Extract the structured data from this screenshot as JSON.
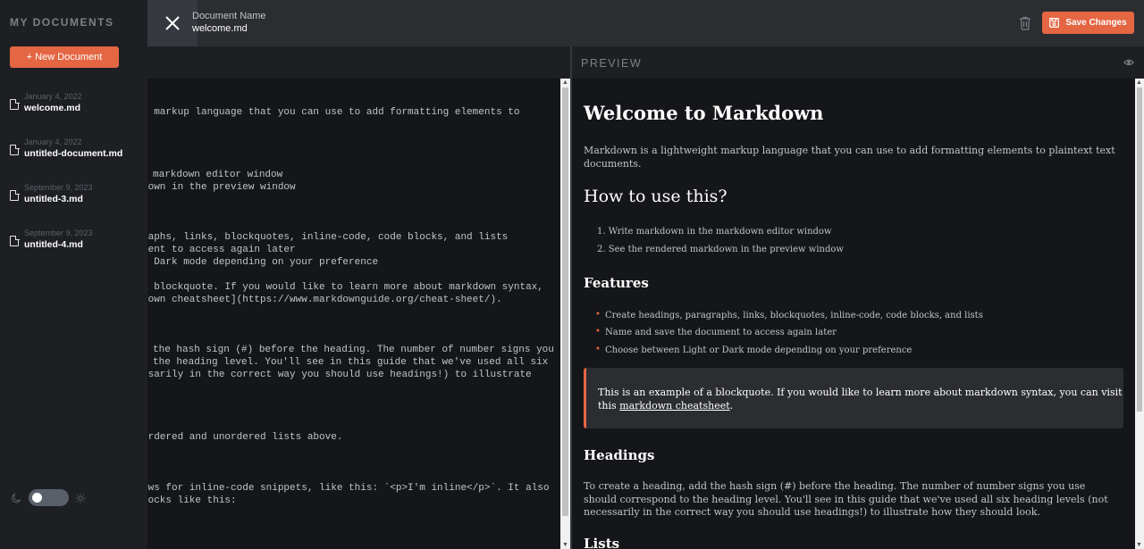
{
  "sidebar": {
    "title": "MY DOCUMENTS",
    "new_document_label": "+ New Document",
    "documents": [
      {
        "date": "January 4, 2022",
        "name": "welcome.md"
      },
      {
        "date": "January 4, 2022",
        "name": "untitled-document.md"
      },
      {
        "date": "September 9, 2023",
        "name": "untitled-3.md"
      },
      {
        "date": "September 9, 2023",
        "name": "untitled-4.md"
      }
    ],
    "theme_toggle_icons": {
      "left": "moon-icon",
      "right": "sun-icon"
    }
  },
  "topbar": {
    "document_label": "Document Name",
    "document_name": "welcome.md",
    "save_label": "Save Changes",
    "icons": {
      "close": "close-icon",
      "delete": "trash-icon",
      "save": "save-icon"
    }
  },
  "editor": {
    "lines": [
      "t markup language that you can use to add formatting elements to",
      ".",
      "markdown editor window",
      "down in the preview window",
      "raphs, links, blockquotes, inline-code, code blocks, and lists",
      "ment to access again later",
      "r Dark mode depending on your preference",
      "a blockquote. If you would like to learn more about markdown syntax,",
      "down cheatsheet](https://www.markdownguide.org/cheat-sheet/).",
      "the hash sign (#) before the heading. The number of number signs you",
      "the heading level. You'll see in this guide that we've used all six",
      "ssarily in the correct way you should use headings!) to illustrate",
      "ordered and unordered lists above.",
      "ows for inline-code snippets, like this: `<p>I'm inline</p>`. It also",
      "locks like this:"
    ]
  },
  "preview": {
    "header_title": "PREVIEW",
    "h1": "Welcome to Markdown",
    "intro": "Markdown is a lightweight markup language that you can use to add formatting elements to plaintext text documents.",
    "h2": "How to use this?",
    "ordered_list": [
      "Write markdown in the markdown editor window",
      "See the rendered markdown in the preview window"
    ],
    "features_heading": "Features",
    "features_list": [
      "Create headings, paragraphs, links, blockquotes, inline-code, code blocks, and lists",
      "Name and save the document to access again later",
      "Choose between Light or Dark mode depending on your preference"
    ],
    "blockquote_text": "This is an example of a blockquote. If you would like to learn more about markdown syntax, you can visit this",
    "blockquote_link": "markdown cheatsheet",
    "blockquote_end": ".",
    "headings_heading": "Headings",
    "headings_text": "To create a heading, add the hash sign (#) before the heading. The number of number signs you use should correspond to the heading level. You'll see in this guide that we've used all six heading levels (not necessarily in the correct way you should use headings!) to illustrate how they should look.",
    "lists_heading": "Lists"
  },
  "colors": {
    "accent": "#e46643",
    "sidebar_bg": "#1d1f22",
    "topbar_bg": "#2b2d31",
    "page_bg": "#151619"
  }
}
